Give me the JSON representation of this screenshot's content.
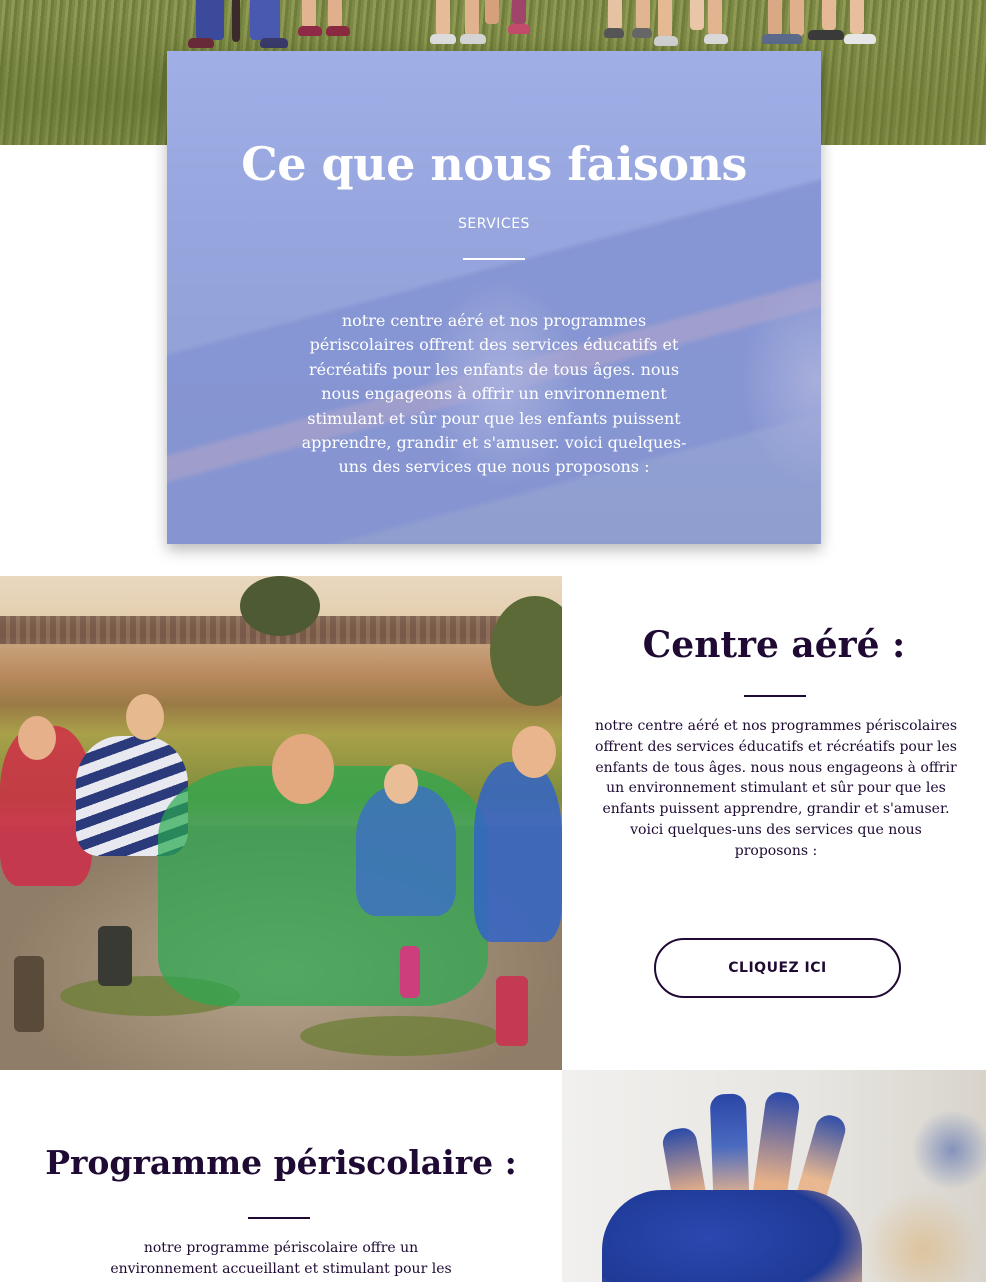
{
  "services": {
    "title": "Ce que nous faisons",
    "subtitle": "SERVICES",
    "text": "notre centre aéré et nos programmes périscolaires offrent des services éducatifs et récréatifs pour les enfants de tous âges. nous nous engageons à offrir un environnement stimulant et sûr pour que les enfants puissent apprendre, grandir et s'amuser. voici quelques-uns des services que nous proposons :"
  },
  "centre_aere": {
    "title": "Centre aéré :",
    "text": "notre centre aéré et nos programmes périscolaires offrent des services éducatifs et récréatifs pour les enfants de tous âges. nous nous engageons à offrir un environnement stimulant et sûr pour que les enfants puissent apprendre, grandir et s'amuser. voici quelques-uns des services que nous proposons :",
    "button_label": "CLIQUEZ ICI"
  },
  "programme": {
    "title": "Programme périscolaire :",
    "text": "notre programme périscolaire offre un environnement accueillant et stimulant pour les"
  },
  "colors": {
    "primary": "#1e0a33",
    "overlay": "#9eacee",
    "white": "#ffffff"
  }
}
